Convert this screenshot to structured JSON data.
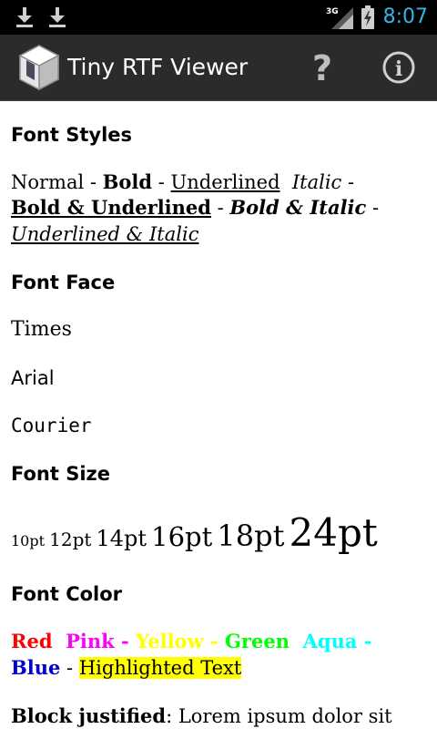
{
  "status_bar": {
    "time": "8:07",
    "network": "3G",
    "icons": [
      "download-icon",
      "download-icon",
      "signal-icon",
      "battery-icon"
    ]
  },
  "action_bar": {
    "title": "Tiny RTF Viewer",
    "help_icon": "?",
    "info_icon": "i"
  },
  "colors": {
    "status_bar_bg": "#000000",
    "action_bar_bg": "#2b2b2b",
    "time_color": "#33b5e5",
    "red": "#ff0000",
    "pink": "#ff00ff",
    "yellow": "#ffff00",
    "green": "#00ff00",
    "aqua": "#00ffff",
    "blue": "#0000cc",
    "highlight": "#ffff00"
  },
  "document": {
    "font_styles_heading": "Font Styles",
    "styles": {
      "normal": "Normal",
      "bold": "Bold",
      "underlined": "Underlined",
      "italic": "Italic",
      "bold_underlined": "Bold & Underlined",
      "bold_italic": "Bold & Italic",
      "underlined_italic": "Underlined & Italic",
      "sep": " - "
    },
    "font_face_heading": "Font Face",
    "faces": {
      "times": "Times",
      "arial": "Arial",
      "courier": "Courier"
    },
    "font_size_heading": "Font Size",
    "sizes": [
      "10pt",
      "12pt",
      "14pt",
      "16pt",
      "18pt",
      "24pt"
    ],
    "font_color_heading": "Font Color",
    "colors_text": {
      "red": "Red",
      "pink": "Pink",
      "yellow": "Yellow",
      "green": "Green",
      "aqua": "Aqua",
      "blue": "Blue",
      "highlighted": "Highlighted Text",
      "dash": "-"
    },
    "justified_label": "Block justified",
    "justified_text": ": Lorem ipsum dolor sit"
  }
}
